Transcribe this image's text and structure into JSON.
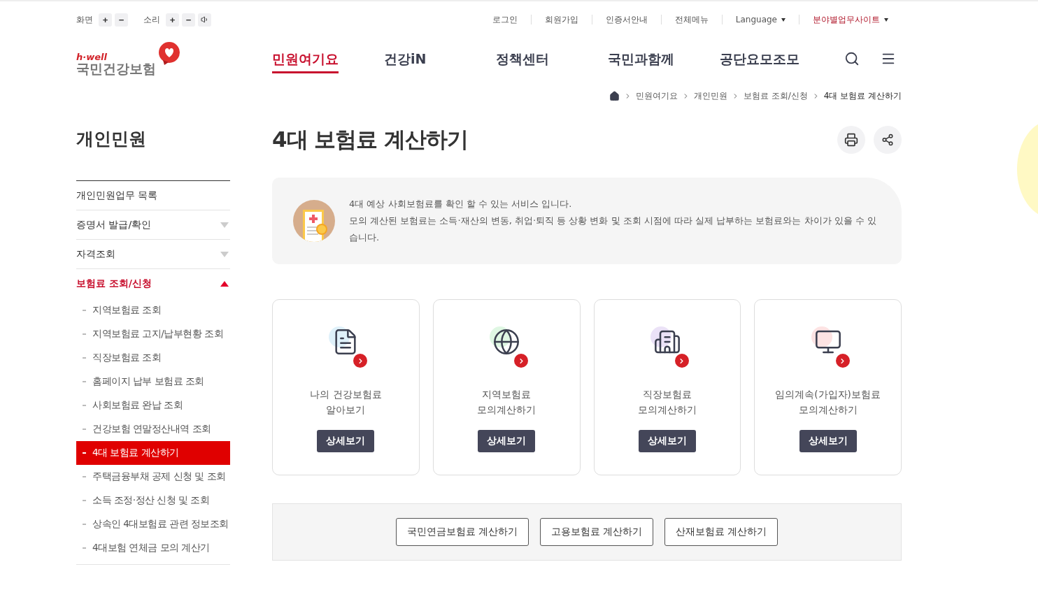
{
  "accessibility": {
    "screen_label": "화면",
    "sound_label": "소리",
    "screen_buttons": [
      "+",
      "−"
    ],
    "sound_buttons": [
      "+",
      "−"
    ]
  },
  "utility_links": [
    {
      "label": "로그인",
      "kind": "link"
    },
    {
      "label": "회원가입",
      "kind": "link"
    },
    {
      "label": "인증서안내",
      "kind": "link"
    },
    {
      "label": "전체메뉴",
      "kind": "link"
    },
    {
      "label": "Language",
      "kind": "dropdown"
    },
    {
      "label": "분야별업무사이트",
      "kind": "highlight"
    }
  ],
  "logo": {
    "tagline": "h·well",
    "name": "국민건강보험"
  },
  "nav": [
    {
      "label": "민원여기요",
      "selected": true
    },
    {
      "label": "건강iN",
      "selected": false
    },
    {
      "label": "정책센터",
      "selected": false
    },
    {
      "label": "국민과함께",
      "selected": false
    },
    {
      "label": "공단요모조모",
      "selected": false
    }
  ],
  "breadcrumb": [
    "민원여기요",
    "개인민원",
    "보험료 조회/신청",
    "4대 보험료 계산하기"
  ],
  "sidebar": {
    "title": "개인민원",
    "items": [
      {
        "label": "개인민원업무 목록",
        "kind": "link",
        "selected": false
      },
      {
        "label": "증명서 발급/확인",
        "kind": "group",
        "selected": false,
        "expanded": false
      },
      {
        "label": "자격조회",
        "kind": "group",
        "selected": false,
        "expanded": false
      },
      {
        "label": "보험료 조회/신청",
        "kind": "group",
        "selected": true,
        "expanded": true,
        "children": [
          {
            "label": "지역보험료 조회",
            "selected": false
          },
          {
            "label": "지역보험료 고지/납부현황 조회",
            "selected": false
          },
          {
            "label": "직장보험료 조회",
            "selected": false
          },
          {
            "label": "홈페이지 납부 보험료 조회",
            "selected": false
          },
          {
            "label": "사회보험료 완납 조회",
            "selected": false
          },
          {
            "label": "건강보험 연말정산내역 조회",
            "selected": false
          },
          {
            "label": "4대 보험료 계산하기",
            "selected": true
          },
          {
            "label": "주택금융부채 공제 신청 및 조회",
            "selected": false
          },
          {
            "label": "소득 조정·정산 신청 및 조회",
            "selected": false
          },
          {
            "label": "상속인 4대보험료 관련 정보조회",
            "selected": false
          },
          {
            "label": "4대보험 연체금 모의 계산기",
            "selected": false
          }
        ]
      }
    ]
  },
  "page_title": "4대 보험료 계산하기",
  "notice": [
    "4대 예상 사회보험료를 확인 할 수 있는 서비스 입니다.",
    "모의 계산된 보험료는 소득·재산의 변동, 취업·퇴직 등 상황 변화 및 조회 시점에 따라 실제 납부하는 보험료와는 차이가 있을 수 있습니다."
  ],
  "cards": [
    {
      "kind": "document",
      "color": "#dff1fa",
      "lines": [
        "나의 건강보험료",
        "알아보기"
      ],
      "button": "상세보기"
    },
    {
      "kind": "globe",
      "color": "#dff7e3",
      "lines": [
        "지역보험료",
        "모의계산하기"
      ],
      "button": "상세보기"
    },
    {
      "kind": "building",
      "color": "#ebe2f7",
      "lines": [
        "직장보험료",
        "모의계산하기"
      ],
      "button": "상세보기"
    },
    {
      "kind": "monitor",
      "color": "#fde3e3",
      "lines": [
        "임의계속(가입자)보험료",
        "모의계산하기"
      ],
      "button": "상세보기"
    }
  ],
  "calc_links": [
    "국민연금보험료 계산하기",
    "고용보험료 계산하기",
    "산재보험료 계산하기"
  ]
}
